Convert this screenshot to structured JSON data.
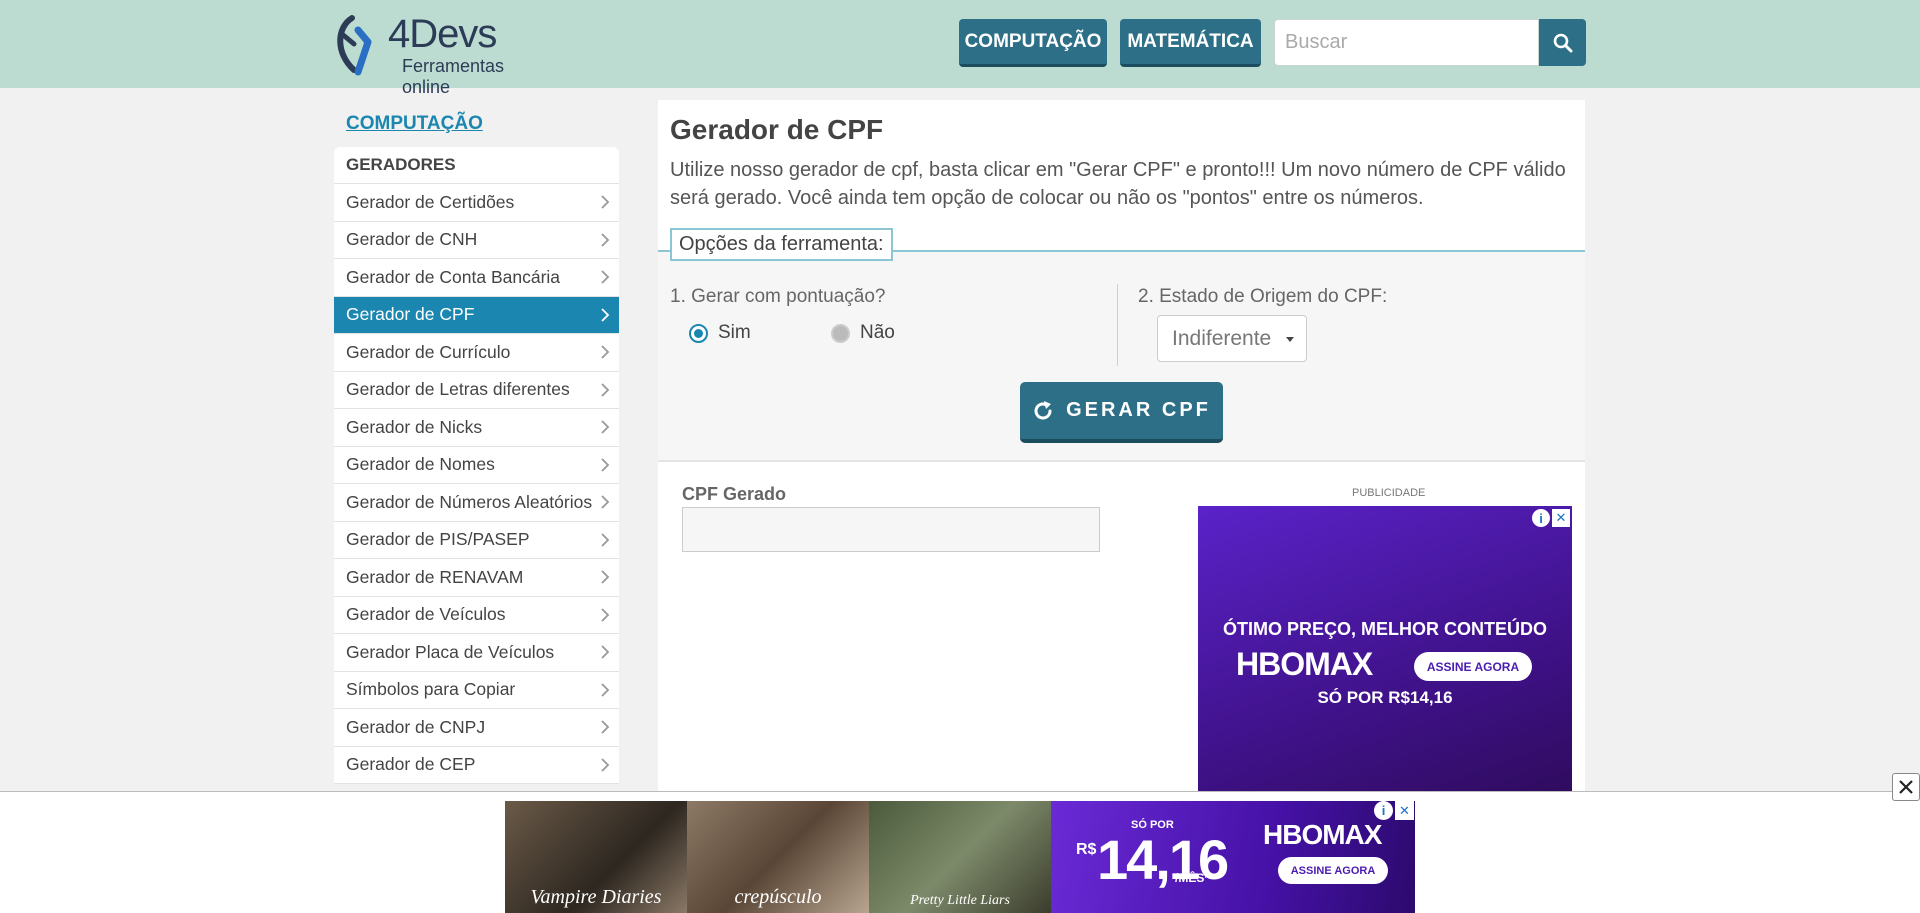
{
  "header": {
    "logo_title": "4Devs",
    "logo_subtitle": "Ferramentas online",
    "nav": [
      {
        "label": "COMPUTAÇÃO"
      },
      {
        "label": "MATEMÁTICA"
      }
    ],
    "search_placeholder": "Buscar"
  },
  "sidebar": {
    "title": "COMPUTAÇÃO",
    "section": "GERADORES",
    "items": [
      {
        "label": "Gerador de Certidões"
      },
      {
        "label": "Gerador de CNH"
      },
      {
        "label": "Gerador de Conta Bancária"
      },
      {
        "label": "Gerador de CPF",
        "active": true
      },
      {
        "label": "Gerador de Currículo"
      },
      {
        "label": "Gerador de Letras diferentes"
      },
      {
        "label": "Gerador de Nicks"
      },
      {
        "label": "Gerador de Nomes"
      },
      {
        "label": "Gerador de Números Aleatórios"
      },
      {
        "label": "Gerador de PIS/PASEP"
      },
      {
        "label": "Gerador de RENAVAM"
      },
      {
        "label": "Gerador de Veículos"
      },
      {
        "label": "Gerador Placa de Veículos"
      },
      {
        "label": "Símbolos para Copiar"
      },
      {
        "label": "Gerador de CNPJ"
      },
      {
        "label": "Gerador de CEP"
      }
    ]
  },
  "main": {
    "title": "Gerador de CPF",
    "description": "Utilize nosso gerador de cpf, basta clicar em \"Gerar CPF\" e pronto!!! Um novo número de CPF válido será gerado. Você ainda tem opção de colocar ou não os \"pontos\" entre os números.",
    "options_legend": "Opções da ferramenta:",
    "option1_label": "1. Gerar com pontuação?",
    "radio_yes": "Sim",
    "radio_no": "Não",
    "option1_selected": "Sim",
    "option2_label": "2. Estado de Origem do CPF:",
    "state_select": "Indiferente",
    "generate_button": "GERAR CPF",
    "result_label": "CPF Gerado",
    "result_value": ""
  },
  "ad": {
    "label": "PUBLICIDADE",
    "headline": "ÓTIMO PREÇO, MELHOR CONTEÚDO",
    "brand": "HBOMAX",
    "cta": "ASSINE AGORA",
    "price": "SÓ POR R$14,16"
  },
  "bottom_ad": {
    "titles": [
      "Vampire Diaries",
      "crepúsculo",
      "Pretty Little Liars"
    ],
    "so_por": "SÓ POR",
    "currency": "R$",
    "price": "14,16",
    "per_month": "/MÊS*",
    "brand": "HBOMAX",
    "cta": "ASSINE AGORA"
  },
  "colors": {
    "header_bg": "#bcdcd2",
    "accent": "#1b87b0",
    "button": "#2c6f87",
    "ad_purple": "#4a1cb0"
  }
}
